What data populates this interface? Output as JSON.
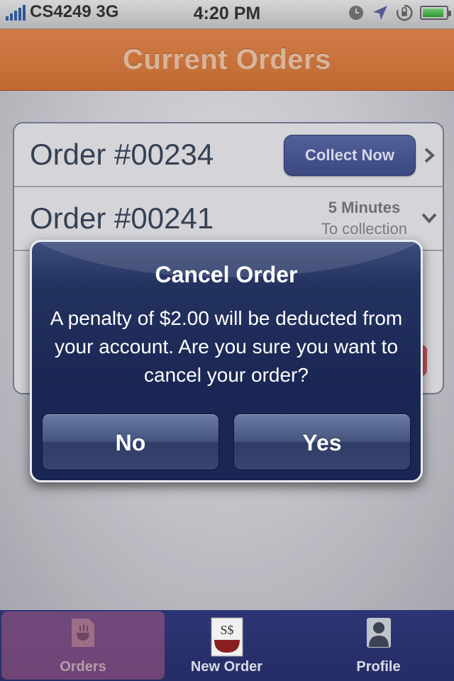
{
  "status_bar": {
    "carrier": "CS4249 3G",
    "time": "4:20 PM",
    "icons": [
      "signal-bars-icon",
      "clock-icon",
      "location-arrow-icon",
      "rotation-lock-icon",
      "battery-icon"
    ],
    "battery_level": 0.9
  },
  "nav": {
    "title": "Current Orders"
  },
  "orders": [
    {
      "label": "Order #00234",
      "action": "Collect Now"
    },
    {
      "label": "Order #00241",
      "eta_value": "5 Minutes",
      "eta_caption": "To collection"
    }
  ],
  "alert": {
    "title": "Cancel Order",
    "message": "A penalty of $2.00 will be deducted from your account. Are you sure you want to cancel your order?",
    "no_label": "No",
    "yes_label": "Yes"
  },
  "tabbar": {
    "items": [
      {
        "label": "Orders",
        "icon": "food-bowl-icon",
        "selected": true
      },
      {
        "label": "New Order",
        "icon": "menu-card-icon",
        "selected": false
      },
      {
        "label": "Profile",
        "icon": "person-icon",
        "selected": false
      }
    ]
  },
  "colors": {
    "nav_orange": "#e07c3a",
    "alert_navy": "#1a2754",
    "button_blue": "#4a5a98",
    "tabbar_navy": "#2a3270"
  }
}
